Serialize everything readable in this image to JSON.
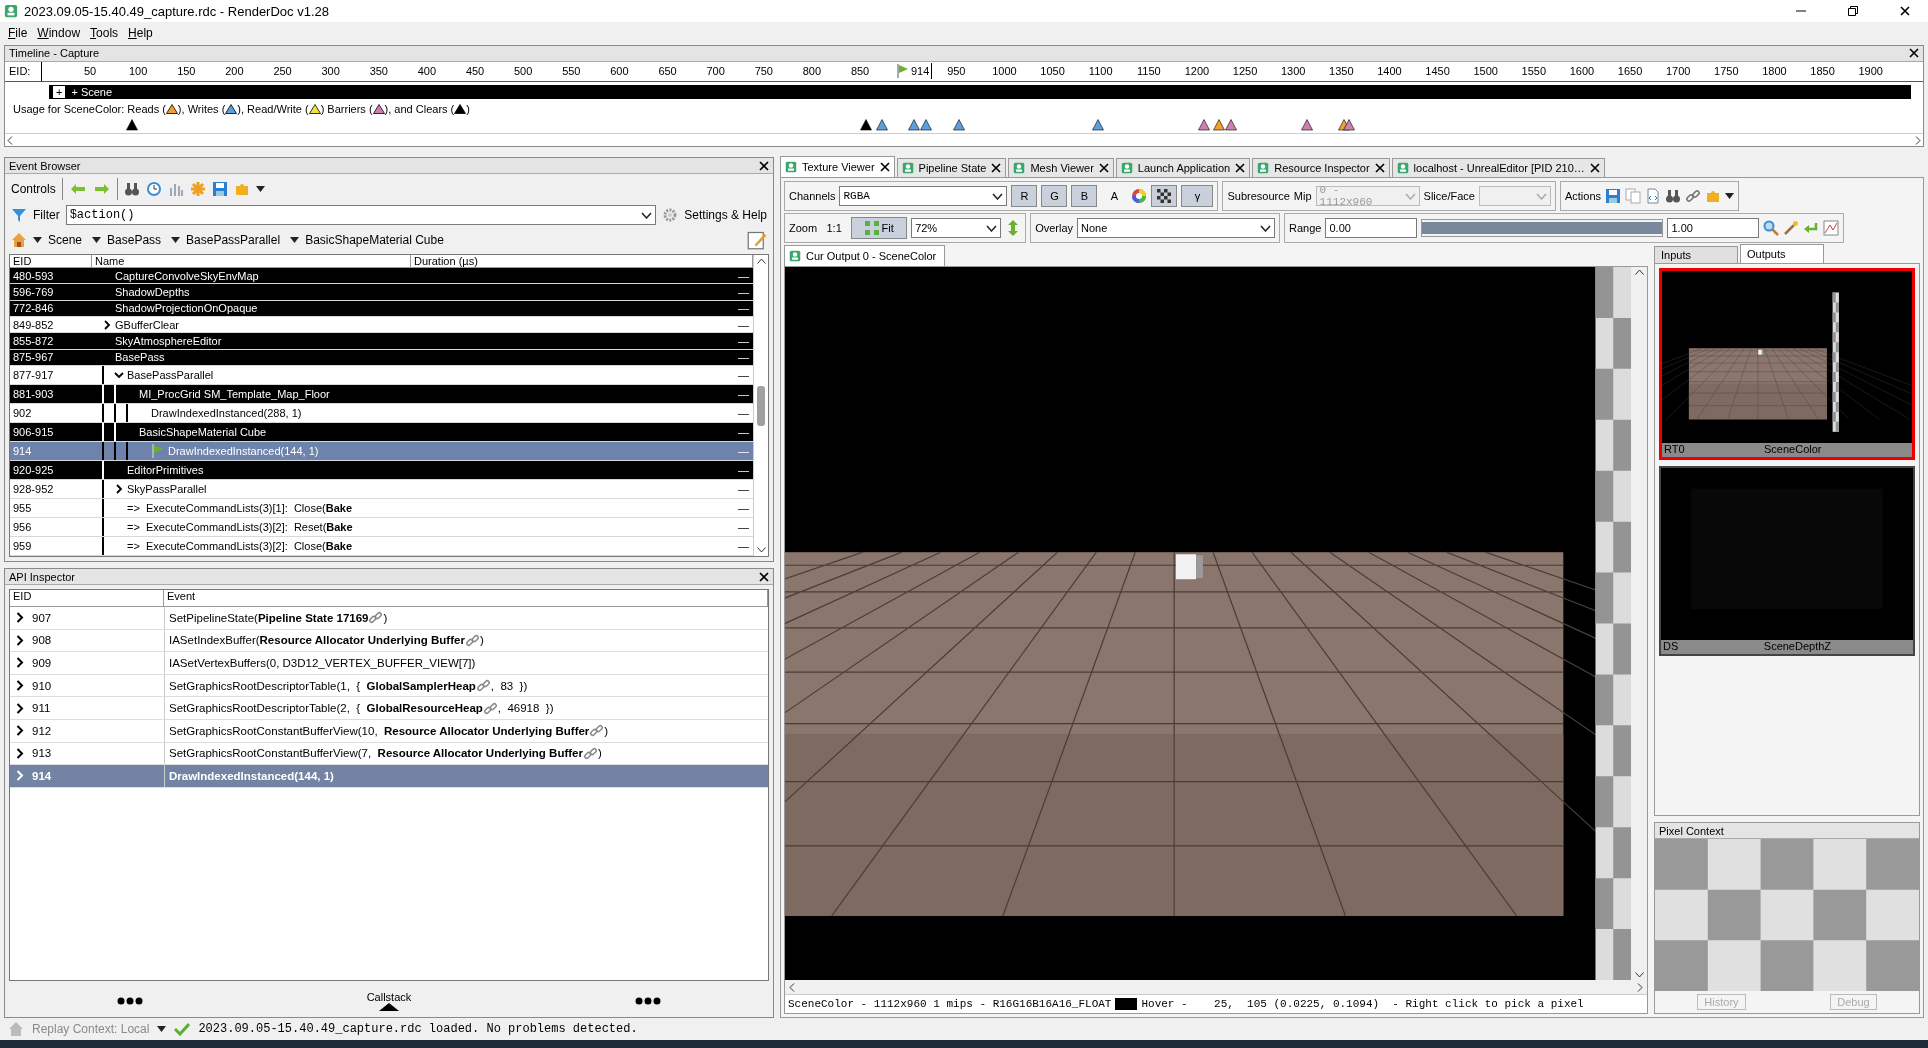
{
  "window": {
    "title": "2023.09.05-15.40.49_capture.rdc - RenderDoc v1.28"
  },
  "menu": [
    {
      "label": "File"
    },
    {
      "label": "Window"
    },
    {
      "label": "Tools"
    },
    {
      "label": "Help"
    }
  ],
  "timeline": {
    "title": "Timeline - Capture",
    "eid_label": "EID:",
    "ticks_before": [
      "50",
      "100",
      "150",
      "200",
      "250",
      "300",
      "350",
      "400",
      "450",
      "500",
      "550",
      "600",
      "650",
      "700",
      "750",
      "800",
      "850"
    ],
    "ticks_after": [
      "950",
      "1000",
      "1050",
      "1100",
      "1150",
      "1200",
      "1250",
      "1300",
      "1350",
      "1400",
      "1450",
      "1500",
      "1550",
      "1600",
      "1650",
      "1700",
      "1750",
      "1800",
      "1850",
      "1900"
    ],
    "current_eid": "914",
    "section_label": "+ Scene",
    "expand_label": "+",
    "legend": [
      {
        "kind": "text",
        "text": "Usage for SceneColor: Reads ("
      },
      {
        "kind": "marker",
        "color": "#f0a030"
      },
      {
        "kind": "text",
        "text": "), Writes ("
      },
      {
        "kind": "marker",
        "color": "#5aa0e0"
      },
      {
        "kind": "text",
        "text": "), Read/Write ("
      },
      {
        "kind": "marker",
        "color": "#f0e040"
      },
      {
        "kind": "text",
        "text": ") Barriers ("
      },
      {
        "kind": "marker",
        "color": "#d080b0"
      },
      {
        "kind": "text",
        "text": "), and Clears ("
      },
      {
        "kind": "marker",
        "color": "#000000"
      },
      {
        "kind": "text",
        "text": ")"
      }
    ]
  },
  "event_browser": {
    "title": "Event Browser",
    "controls_label": "Controls",
    "filter_label": "Filter",
    "filter_value": "$action()",
    "settings_label": "Settings & Help",
    "breadcrumbs": [
      "Scene",
      "BasePass",
      "BasePassParallel",
      "BasicShapeMaterial Cube"
    ],
    "columns": [
      "EID",
      "Name",
      "Duration (µs)"
    ],
    "rows": [
      {
        "eid": "480-593",
        "name": "CaptureConvolveSkyEnvMap",
        "duration": "—",
        "color": "#000000",
        "selected": false,
        "current": false
      },
      {
        "eid": "596-769",
        "name": "ShadowDepths",
        "duration": "—",
        "color": "#000000",
        "selected": false,
        "current": false
      },
      {
        "eid": "772-846",
        "name": "ShadowProjectionOnOpaque",
        "duration": "—",
        "color": "#000000",
        "selected": false,
        "current": false
      },
      {
        "eid": "849-852",
        "name": "GBufferClear",
        "duration": "—",
        "expanded": false,
        "selected": false,
        "current": false
      },
      {
        "eid": "855-872",
        "name": "SkyAtmosphereEditor",
        "duration": "—",
        "color": "#000000",
        "selected": false,
        "current": false
      },
      {
        "eid": "875-967",
        "name": "BasePass",
        "duration": "—",
        "color": "#000000",
        "selected": false,
        "current": false,
        "children": [
          {
            "eid": "877-917",
            "name": "BasePassParallel",
            "duration": "—",
            "expanded": true,
            "selected": false,
            "current": false,
            "children": [
              {
                "eid": "881-903",
                "name": "MI_ProcGrid SM_Template_Map_Floor",
                "duration": "—",
                "color": "#000000",
                "selected": false,
                "current": false,
                "children": [
                  {
                    "eid": "902",
                    "name": "DrawIndexedInstanced(288, 1)",
                    "duration": "—",
                    "selected": false,
                    "current": false
                  }
                ]
              },
              {
                "eid": "906-915",
                "name": "BasicShapeMaterial Cube",
                "duration": "—",
                "color": "#000000",
                "selected": false,
                "current": false,
                "children": [
                  {
                    "eid": "914",
                    "name": "DrawIndexedInstanced(144, 1)",
                    "duration": "—",
                    "selected": true,
                    "current": true
                  }
                ]
              }
            ]
          },
          {
            "eid": "920-925",
            "name": "EditorPrimitives",
            "duration": "—",
            "color": "#000000",
            "selected": false,
            "current": false
          },
          {
            "eid": "928-952",
            "name": "SkyPassParallel",
            "duration": "—",
            "expanded": false,
            "selected": false,
            "current": false
          },
          {
            "eid": "955",
            "name": "=>  ExecuteCommandLists(3)[1]:  Close(**Bake**",
            "duration": "—",
            "selected": false,
            "current": false
          },
          {
            "eid": "956",
            "name": "=>  ExecuteCommandLists(3)[2]:  Reset(**Bake**",
            "duration": "—",
            "selected": false,
            "current": false
          },
          {
            "eid": "959",
            "name": "=>  ExecuteCommandLists(3)[2]:  Close(**Bake**",
            "duration": "—",
            "selected": false,
            "current": false
          }
        ]
      }
    ]
  },
  "api_inspector": {
    "title": "API Inspector",
    "columns": [
      "EID",
      "Event"
    ],
    "callstack_label": "Callstack",
    "rows": [
      {
        "eid": "907",
        "parts": [
          "SetPipelineState(**Pipeline State 17169**",
          ")"
        ],
        "selected": false
      },
      {
        "eid": "908",
        "parts": [
          "IASetIndexBuffer(**Resource Allocator Underlying Buffer**",
          ")"
        ],
        "selected": false
      },
      {
        "eid": "909",
        "parts": [
          "IASetVertexBuffers(0, D3D12_VERTEX_BUFFER_VIEW[7])"
        ],
        "selected": false
      },
      {
        "eid": "910",
        "parts": [
          "SetGraphicsRootDescriptorTable(1,  {  **GlobalSamplerHeap**",
          ",  83  })"
        ],
        "selected": false
      },
      {
        "eid": "911",
        "parts": [
          "SetGraphicsRootDescriptorTable(2,  {  **GlobalResourceHeap**",
          ",  46918  })"
        ],
        "selected": false
      },
      {
        "eid": "912",
        "parts": [
          "SetGraphicsRootConstantBufferView(10,  **Resource Allocator Underlying Buffer**",
          ")"
        ],
        "selected": false
      },
      {
        "eid": "913",
        "parts": [
          "SetGraphicsRootConstantBufferView(7,  **Resource Allocator Underlying Buffer**",
          ")"
        ],
        "selected": false
      },
      {
        "eid": "914",
        "parts": [
          "DrawIndexedInstanced(144, 1)"
        ],
        "selected": true
      }
    ]
  },
  "tabs": [
    {
      "label": "Texture Viewer",
      "selected": true
    },
    {
      "label": "Pipeline State",
      "selected": false
    },
    {
      "label": "Mesh Viewer",
      "selected": false
    },
    {
      "label": "Launch Application",
      "selected": false
    },
    {
      "label": "Resource Inspector",
      "selected": false
    },
    {
      "label": "localhost - UnrealEditor [PID 210…",
      "selected": false
    }
  ],
  "texture_viewer": {
    "channels_label": "Channels",
    "channels_value": "RGBA",
    "channel_buttons": [
      {
        "label": "R",
        "on": true
      },
      {
        "label": "G",
        "on": true
      },
      {
        "label": "B",
        "on": true
      },
      {
        "label": "A",
        "on": false
      }
    ],
    "checkerboard_on": true,
    "gamma": {
      "label": "γ",
      "on": true
    },
    "subresource_label": "Subresource",
    "mip": {
      "label": "Mip",
      "value": "0 - 1112x960",
      "disabled": true
    },
    "slice": {
      "label": "Slice/Face",
      "disabled": true
    },
    "actions_label": "Actions",
    "zoom_label": "Zoom",
    "zoom_ratio": "1:1",
    "fit": {
      "label": "Fit",
      "on": true
    },
    "zoom_value": "72%",
    "overlay": {
      "label": "Overlay",
      "value": "None"
    },
    "range": {
      "label": "Range",
      "min": "0.00",
      "max": "1.00",
      "level": 1
    },
    "viewer_tab": "Cur Output 0 - SceneColor",
    "status": {
      "info": "SceneColor - 1112x960 1 mips - R16G16B16A16_FLOAT",
      "swatch": {
        "color": "#000000"
      },
      "hover": "Hover -    25,  105 (0.0225, 0.1094)  - Right click to pick a pixel"
    }
  },
  "side_panel": {
    "tabs": [
      {
        "label": "Inputs",
        "selected": false
      },
      {
        "label": "Outputs",
        "selected": true
      }
    ],
    "thumbnails": [
      {
        "slot": "RT0",
        "name": "SceneColor",
        "kind": "color",
        "selected": true
      },
      {
        "slot": "DS",
        "name": "SceneDepthZ",
        "kind": "depth",
        "selected": false
      }
    ],
    "pixel_context": {
      "title": "Pixel Context",
      "buttons": [
        {
          "label": "History",
          "disabled": true
        },
        {
          "label": "Debug",
          "disabled": true
        }
      ]
    }
  },
  "status_bar": {
    "context": "Replay Context: Local",
    "message": "2023.09.05-15.40.49_capture.rdc loaded. No problems detected."
  }
}
